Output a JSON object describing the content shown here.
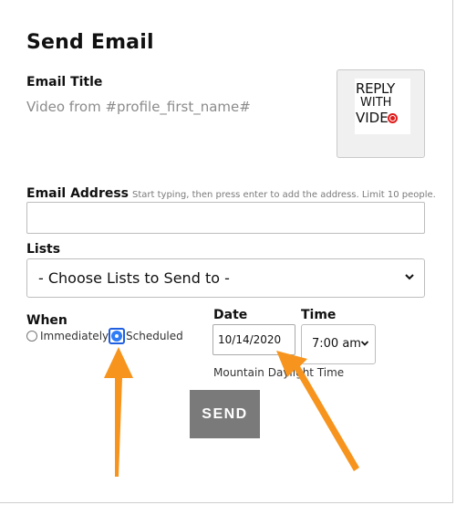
{
  "page": {
    "title": "Send Email"
  },
  "email_title": {
    "label": "Email Title",
    "value": "Video from #profile_first_name#"
  },
  "thumbnail": {
    "line1": "REPLY",
    "line2": "WITH",
    "line3": "VIDE"
  },
  "email_address": {
    "label": "Email Address",
    "hint": "Start typing, then press enter to add the address. Limit 10 people.",
    "value": ""
  },
  "lists": {
    "label": "Lists",
    "selected": "- Choose Lists to Send to -"
  },
  "when": {
    "label": "When",
    "options": [
      "Immediately",
      "Scheduled"
    ],
    "selected": "Scheduled"
  },
  "date": {
    "label": "Date",
    "value": "10/14/2020"
  },
  "time": {
    "label": "Time",
    "value": "7:00 am"
  },
  "timezone": "Mountain Daylight Time",
  "send_button": "SEND",
  "colors": {
    "annotation_arrow": "#f7941d",
    "radio_selected": "#2f7cf6",
    "send_button_bg": "#7a7a7a",
    "record_dot": "#e01b1b"
  }
}
